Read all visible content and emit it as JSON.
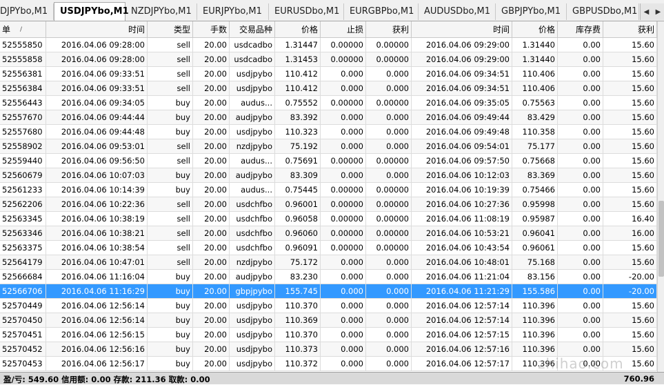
{
  "tabs": [
    "DJPYbo,M1",
    "USDJPYbo,M1",
    "NZDJPYbo,M1",
    "EURJPYbo,M1",
    "EURUSDbo,M1",
    "EURGBPbo,M1",
    "AUDUSDbo,M1",
    "GBPJPYbo,M1",
    "GBPUSDbo,M1"
  ],
  "active_tab": 1,
  "columns": [
    "单",
    "时间",
    "类型",
    "手数",
    "交易品种",
    "价格",
    "止损",
    "获利",
    "时间",
    "价格",
    "库存费",
    "获利"
  ],
  "sort_indicator": "/",
  "rows": [
    [
      "52555850",
      "2016.04.06 09:28:00",
      "sell",
      "20.00",
      "usdcadbo",
      "1.31447",
      "0.00000",
      "0.00000",
      "2016.04.06 09:29:00",
      "1.31440",
      "0.00",
      "15.60"
    ],
    [
      "52555858",
      "2016.04.06 09:28:00",
      "sell",
      "20.00",
      "usdcadbo",
      "1.31453",
      "0.00000",
      "0.00000",
      "2016.04.06 09:29:00",
      "1.31440",
      "0.00",
      "15.60"
    ],
    [
      "52556381",
      "2016.04.06 09:33:51",
      "sell",
      "20.00",
      "usdjpybo",
      "110.412",
      "0.000",
      "0.000",
      "2016.04.06 09:34:51",
      "110.406",
      "0.00",
      "15.60"
    ],
    [
      "52556384",
      "2016.04.06 09:33:51",
      "sell",
      "20.00",
      "usdjpybo",
      "110.412",
      "0.000",
      "0.000",
      "2016.04.06 09:34:51",
      "110.406",
      "0.00",
      "15.60"
    ],
    [
      "52556443",
      "2016.04.06 09:34:05",
      "buy",
      "20.00",
      "audus...",
      "0.75552",
      "0.00000",
      "0.00000",
      "2016.04.06 09:35:05",
      "0.75563",
      "0.00",
      "15.60"
    ],
    [
      "52557670",
      "2016.04.06 09:44:44",
      "buy",
      "20.00",
      "audjpybo",
      "83.392",
      "0.000",
      "0.000",
      "2016.04.06 09:49:44",
      "83.429",
      "0.00",
      "15.60"
    ],
    [
      "52557680",
      "2016.04.06 09:44:48",
      "buy",
      "20.00",
      "usdjpybo",
      "110.323",
      "0.000",
      "0.000",
      "2016.04.06 09:49:48",
      "110.358",
      "0.00",
      "15.60"
    ],
    [
      "52558902",
      "2016.04.06 09:53:01",
      "sell",
      "20.00",
      "nzdjpybo",
      "75.192",
      "0.000",
      "0.000",
      "2016.04.06 09:54:01",
      "75.177",
      "0.00",
      "15.60"
    ],
    [
      "52559440",
      "2016.04.06 09:56:50",
      "sell",
      "20.00",
      "audus...",
      "0.75691",
      "0.00000",
      "0.00000",
      "2016.04.06 09:57:50",
      "0.75668",
      "0.00",
      "15.60"
    ],
    [
      "52560679",
      "2016.04.06 10:07:03",
      "buy",
      "20.00",
      "audjpybo",
      "83.309",
      "0.000",
      "0.000",
      "2016.04.06 10:12:03",
      "83.369",
      "0.00",
      "15.60"
    ],
    [
      "52561233",
      "2016.04.06 10:14:39",
      "buy",
      "20.00",
      "audus...",
      "0.75445",
      "0.00000",
      "0.00000",
      "2016.04.06 10:19:39",
      "0.75466",
      "0.00",
      "15.60"
    ],
    [
      "52562206",
      "2016.04.06 10:22:36",
      "sell",
      "20.00",
      "usdchfbo",
      "0.96001",
      "0.00000",
      "0.00000",
      "2016.04.06 10:27:36",
      "0.95998",
      "0.00",
      "15.60"
    ],
    [
      "52563345",
      "2016.04.06 10:38:19",
      "sell",
      "20.00",
      "usdchfbo",
      "0.96058",
      "0.00000",
      "0.00000",
      "2016.04.06 11:08:19",
      "0.95987",
      "0.00",
      "16.40"
    ],
    [
      "52563346",
      "2016.04.06 10:38:21",
      "sell",
      "20.00",
      "usdchfbo",
      "0.96060",
      "0.00000",
      "0.00000",
      "2016.04.06 10:53:21",
      "0.96041",
      "0.00",
      "16.00"
    ],
    [
      "52563375",
      "2016.04.06 10:38:54",
      "sell",
      "20.00",
      "usdchfbo",
      "0.96091",
      "0.00000",
      "0.00000",
      "2016.04.06 10:43:54",
      "0.96061",
      "0.00",
      "15.60"
    ],
    [
      "52564179",
      "2016.04.06 10:47:01",
      "sell",
      "20.00",
      "nzdjpybo",
      "75.172",
      "0.000",
      "0.000",
      "2016.04.06 10:48:01",
      "75.168",
      "0.00",
      "15.60"
    ],
    [
      "52566684",
      "2016.04.06 11:16:04",
      "buy",
      "20.00",
      "audjpybo",
      "83.230",
      "0.000",
      "0.000",
      "2016.04.06 11:21:04",
      "83.156",
      "0.00",
      "-20.00"
    ],
    [
      "52566706",
      "2016.04.06 11:16:29",
      "buy",
      "20.00",
      "gbpjpybo",
      "155.745",
      "0.000",
      "0.000",
      "2016.04.06 11:21:29",
      "155.586",
      "0.00",
      "-20.00"
    ],
    [
      "52570449",
      "2016.04.06 12:56:14",
      "buy",
      "20.00",
      "usdjpybo",
      "110.370",
      "0.000",
      "0.000",
      "2016.04.06 12:57:14",
      "110.396",
      "0.00",
      "15.60"
    ],
    [
      "52570450",
      "2016.04.06 12:56:14",
      "buy",
      "20.00",
      "usdjpybo",
      "110.369",
      "0.000",
      "0.000",
      "2016.04.06 12:57:14",
      "110.396",
      "0.00",
      "15.60"
    ],
    [
      "52570451",
      "2016.04.06 12:56:15",
      "buy",
      "20.00",
      "usdjpybo",
      "110.370",
      "0.000",
      "0.000",
      "2016.04.06 12:57:15",
      "110.396",
      "0.00",
      "15.60"
    ],
    [
      "52570452",
      "2016.04.06 12:56:16",
      "buy",
      "20.00",
      "usdjpybo",
      "110.373",
      "0.000",
      "0.000",
      "2016.04.06 12:57:16",
      "110.396",
      "0.00",
      "15.60"
    ],
    [
      "52570453",
      "2016.04.06 12:56:17",
      "buy",
      "20.00",
      "usdjpybo",
      "110.372",
      "0.000",
      "0.000",
      "2016.04.06 12:57:17",
      "110.396",
      "0.00",
      "15.60"
    ]
  ],
  "selected_row": 17,
  "footer": {
    "summary": "盈/亏: 549.60  信用额: 0.00  存款: 211.36  取款: 0.00",
    "total": "760.96"
  },
  "watermark": "zhihao.com",
  "colors": {
    "selection": "#3399ff",
    "header_bg": "#f5f5f5",
    "footer_bg": "#d9d9d9"
  },
  "icons": {
    "tab_scroll_left": "triangle-left",
    "tab_scroll_right": "triangle-right"
  }
}
